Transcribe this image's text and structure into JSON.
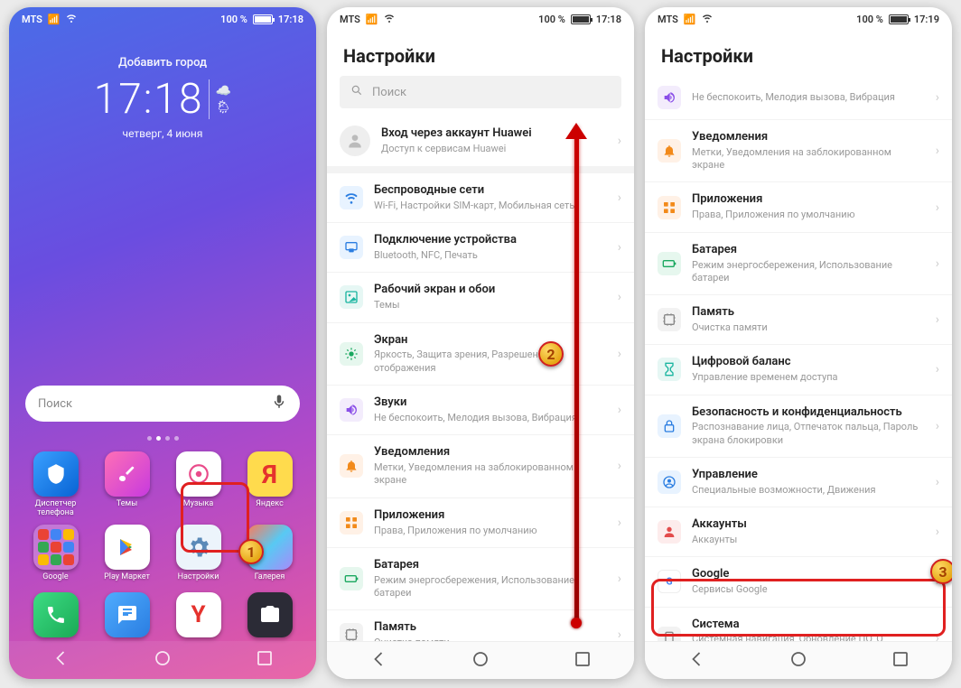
{
  "carrier": "MTS",
  "battery_pct": "100 %",
  "home": {
    "time": "17:18",
    "date": "четверг, 4 июня",
    "add_city": "Добавить город",
    "search_placeholder": "Поиск",
    "apps": [
      {
        "label": "Диспетчер телефона"
      },
      {
        "label": "Темы"
      },
      {
        "label": "Музыка"
      },
      {
        "label": "Яндекс"
      },
      {
        "label": "Google"
      },
      {
        "label": "Play Маркет"
      },
      {
        "label": "Настройки"
      },
      {
        "label": "Галерея"
      }
    ]
  },
  "s1": {
    "time": "17:18",
    "title": "Настройки",
    "search": "Поиск",
    "acct_t": "Вход через аккаунт Huawei",
    "acct_s": "Доступ к сервисам Huawei",
    "items": [
      {
        "t": "Беспроводные сети",
        "s": "Wi-Fi, Настройки SIM-карт, Мобильная сеть",
        "c": "b",
        "ic": "wifi"
      },
      {
        "t": "Подключение устройства",
        "s": "Bluetooth, NFC, Печать",
        "c": "b",
        "ic": "link"
      },
      {
        "t": "Рабочий экран и обои",
        "s": "Темы",
        "c": "t",
        "ic": "img"
      },
      {
        "t": "Экран",
        "s": "Яркость, Защита зрения, Разрешение и отображения",
        "c": "g",
        "ic": "bright"
      },
      {
        "t": "Звуки",
        "s": "Не беспокоить, Мелодия вызова, Вибрация",
        "c": "p",
        "ic": "vol"
      },
      {
        "t": "Уведомления",
        "s": "Метки, Уведомления на заблокированном экране",
        "c": "o",
        "ic": "bell"
      },
      {
        "t": "Приложения",
        "s": "Права, Приложения по умолчанию",
        "c": "o",
        "ic": "apps"
      },
      {
        "t": "Батарея",
        "s": "Режим энергосбережения, Использование батареи",
        "c": "g",
        "ic": "bat"
      },
      {
        "t": "Память",
        "s": "Очистка памяти",
        "c": "gr",
        "ic": "mem"
      }
    ]
  },
  "s2": {
    "time": "17:19",
    "title": "Настройки",
    "items": [
      {
        "t": "",
        "s": "Не беспокоить, Мелодия вызова, Вибрация",
        "c": "p",
        "ic": "vol",
        "trunc": true
      },
      {
        "t": "Уведомления",
        "s": "Метки, Уведомления на заблокированном экране",
        "c": "o",
        "ic": "bell"
      },
      {
        "t": "Приложения",
        "s": "Права, Приложения по умолчанию",
        "c": "o",
        "ic": "apps"
      },
      {
        "t": "Батарея",
        "s": "Режим энергосбережения, Использование батареи",
        "c": "g",
        "ic": "bat"
      },
      {
        "t": "Память",
        "s": "Очистка памяти",
        "c": "gr",
        "ic": "mem"
      },
      {
        "t": "Цифровой баланс",
        "s": "Управление временем доступа",
        "c": "t",
        "ic": "hour"
      },
      {
        "t": "Безопасность и конфиденциальность",
        "s": "Распознавание лица, Отпечаток пальца, Пароль экрана блокировки",
        "c": "b",
        "ic": "lock"
      },
      {
        "t": "Управление",
        "s": "Специальные возможности, Движения",
        "c": "b",
        "ic": "acc"
      },
      {
        "t": "Аккаунты",
        "s": "Аккаунты",
        "c": "r",
        "ic": "user"
      },
      {
        "t": "Google",
        "s": "Сервисы Google",
        "c": "w",
        "ic": "g"
      },
      {
        "t": "Система",
        "s": "Системная навигация, Обновление ПО, О телефоне, Язык и ввод",
        "c": "gr",
        "ic": "sys"
      }
    ]
  }
}
